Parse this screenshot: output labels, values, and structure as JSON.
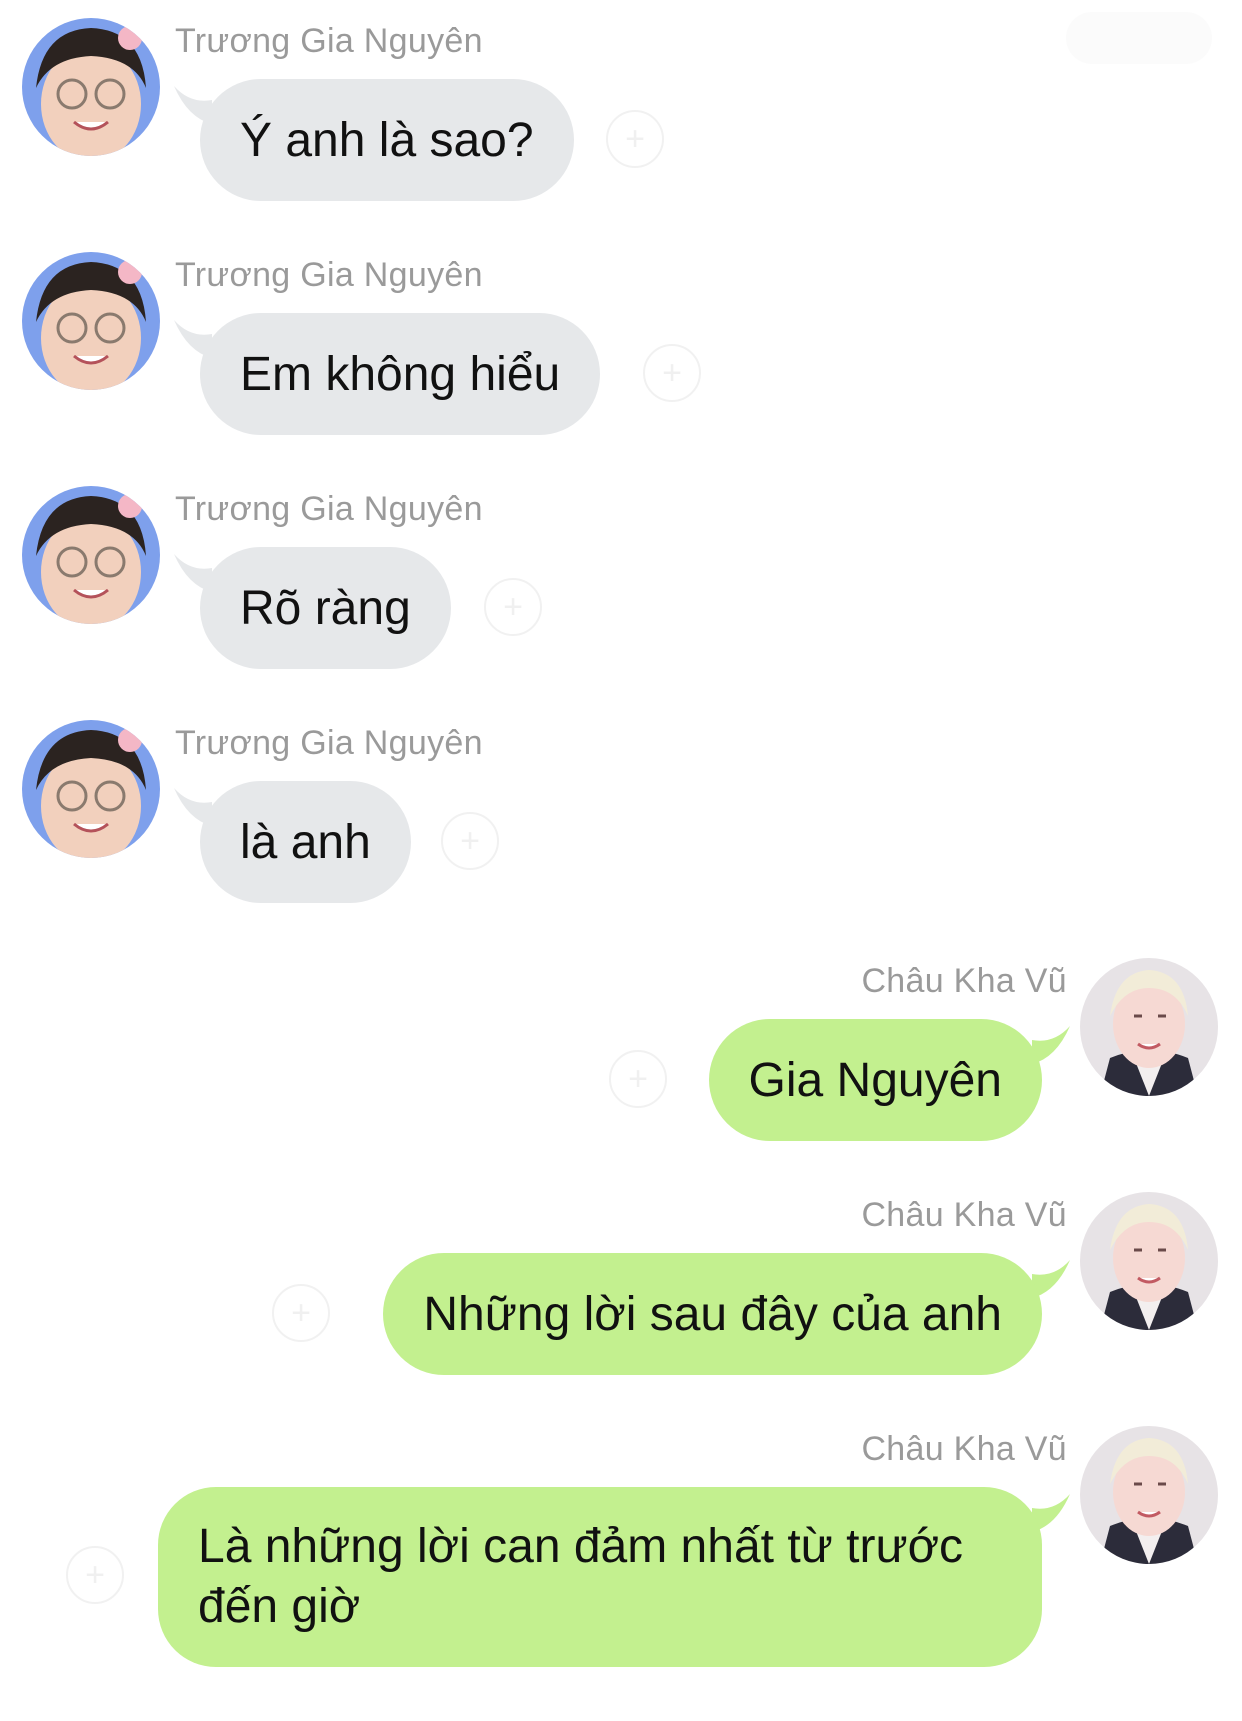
{
  "colors": {
    "incoming_bubble": "#e6e8ea",
    "outgoing_bubble": "#c3f08f",
    "sender_name": "#9a9a9a",
    "message_text": "#111111"
  },
  "icons": {
    "reaction": "plus-circle-icon",
    "avatar_incoming": "avatar-photo",
    "avatar_outgoing": "avatar-photo"
  },
  "messages": [
    {
      "sender": "Trương Gia Nguyên",
      "text": "Ý anh là sao?",
      "direction": "incoming"
    },
    {
      "sender": "Trương Gia Nguyên",
      "text": "Em không hiểu",
      "direction": "incoming"
    },
    {
      "sender": "Trương Gia Nguyên",
      "text": "Rõ ràng",
      "direction": "incoming"
    },
    {
      "sender": "Trương Gia Nguyên",
      "text": "là anh",
      "direction": "incoming"
    },
    {
      "sender": "Châu Kha Vũ",
      "text": "Gia Nguyên",
      "direction": "outgoing"
    },
    {
      "sender": "Châu Kha Vũ",
      "text": "Những lời sau đây của anh",
      "direction": "outgoing"
    },
    {
      "sender": "Châu Kha Vũ",
      "text": "Là những lời can đảm nhất từ trước đến giờ",
      "direction": "outgoing"
    }
  ]
}
